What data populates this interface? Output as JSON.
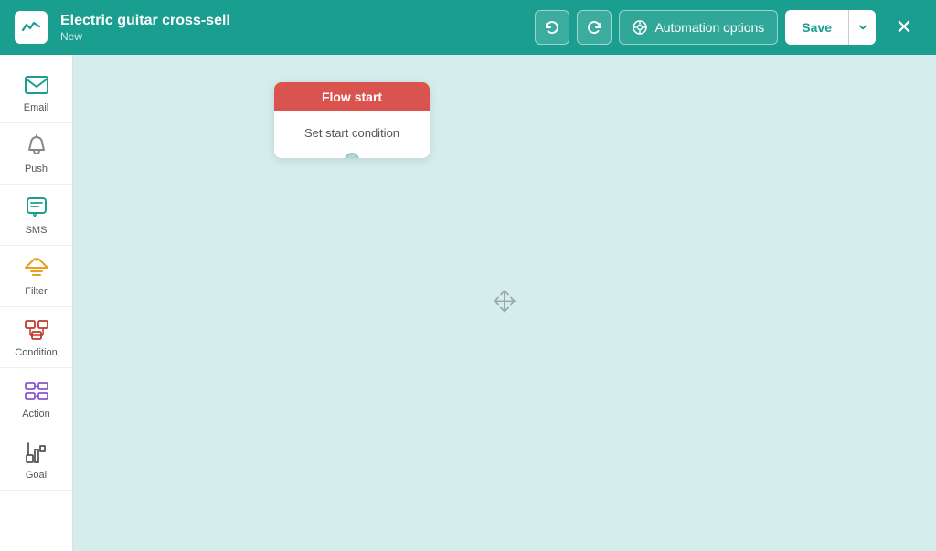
{
  "header": {
    "logo_alt": "App logo",
    "title": "Electric guitar cross-sell",
    "subtitle": "New",
    "undo_label": "Undo",
    "redo_label": "Redo",
    "automation_options_label": "Automation options",
    "save_label": "Save",
    "save_dropdown_label": "More save options",
    "close_label": "Close"
  },
  "sidebar": {
    "items": [
      {
        "id": "email",
        "label": "Email",
        "icon": "email-icon"
      },
      {
        "id": "push",
        "label": "Push",
        "icon": "push-icon"
      },
      {
        "id": "sms",
        "label": "SMS",
        "icon": "sms-icon"
      },
      {
        "id": "filter",
        "label": "Filter",
        "icon": "filter-icon"
      },
      {
        "id": "condition",
        "label": "Condition",
        "icon": "condition-icon"
      },
      {
        "id": "action",
        "label": "Action",
        "icon": "action-icon"
      },
      {
        "id": "goal",
        "label": "Goal",
        "icon": "goal-icon"
      }
    ]
  },
  "canvas": {
    "flow_card": {
      "header": "Flow start",
      "body": "Set start condition"
    }
  }
}
